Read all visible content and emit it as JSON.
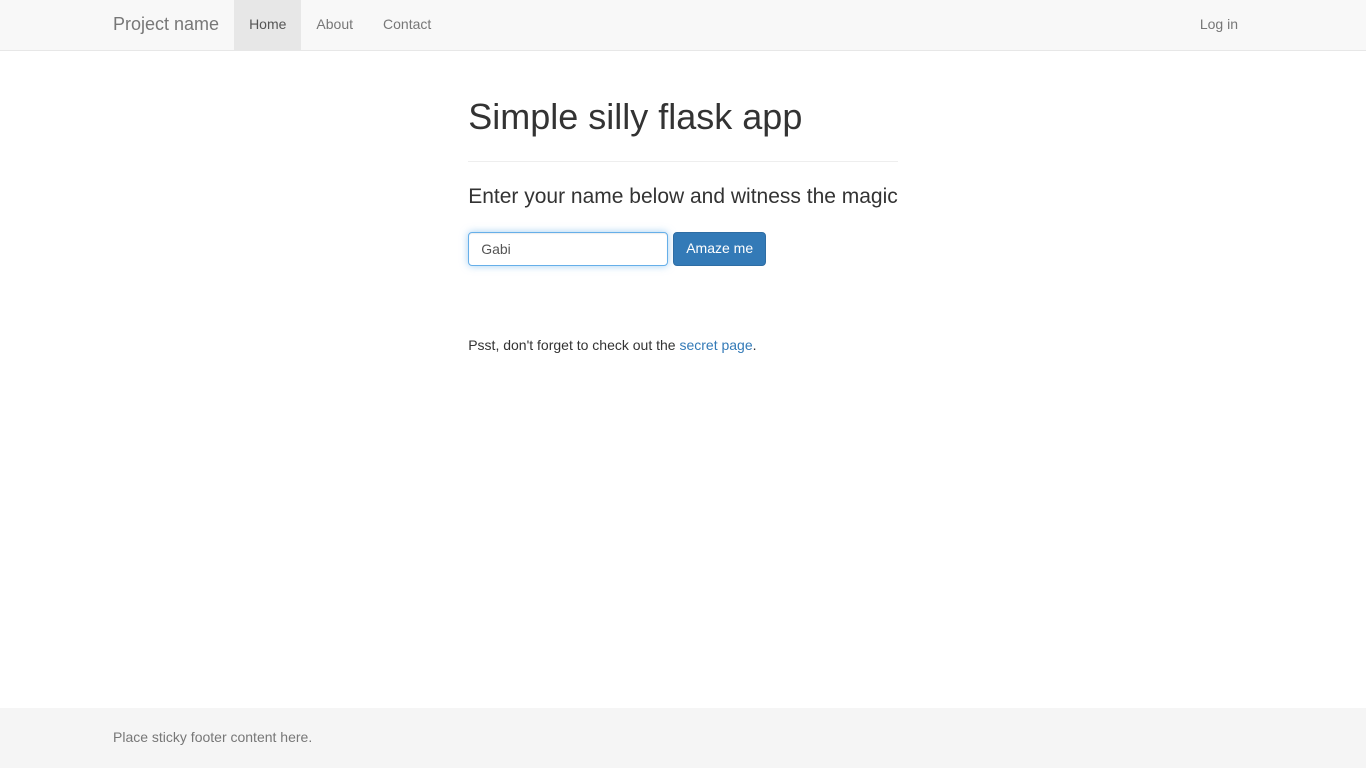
{
  "navbar": {
    "brand": "Project name",
    "items": [
      {
        "label": "Home",
        "active": true
      },
      {
        "label": "About",
        "active": false
      },
      {
        "label": "Contact",
        "active": false
      }
    ],
    "right": {
      "login": "Log in"
    }
  },
  "main": {
    "title": "Simple silly flask app",
    "lead": "Enter your name below and witness the magic",
    "form": {
      "name_value": "Gabi",
      "submit_label": "Amaze me"
    },
    "hint_prefix": "Psst, don't forget to check out the ",
    "hint_link": "secret page",
    "hint_suffix": "."
  },
  "footer": {
    "text": "Place sticky footer content here."
  }
}
